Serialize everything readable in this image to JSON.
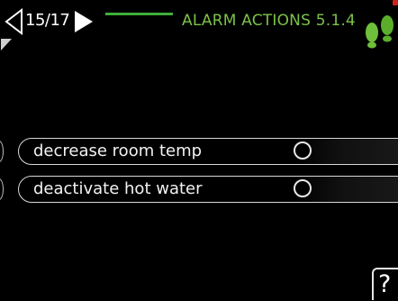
{
  "header": {
    "page_counter": "15/17",
    "title": "ALARM ACTIONS 5.1.4",
    "nav_prev_icon": "chevron-left-outline-icon",
    "nav_next_icon": "play-right-filled-icon",
    "status_icon": "footsteps-icon"
  },
  "options": [
    {
      "label": "decrease room temp",
      "selected": false
    },
    {
      "label": "deactivate hot water",
      "selected": false
    }
  ],
  "help": {
    "label": "?"
  },
  "colors": {
    "accent_green": "#3fae3a",
    "title_green": "#7cc24a",
    "alert_red": "#d4201c",
    "background": "#000000",
    "text": "#ffffff"
  }
}
